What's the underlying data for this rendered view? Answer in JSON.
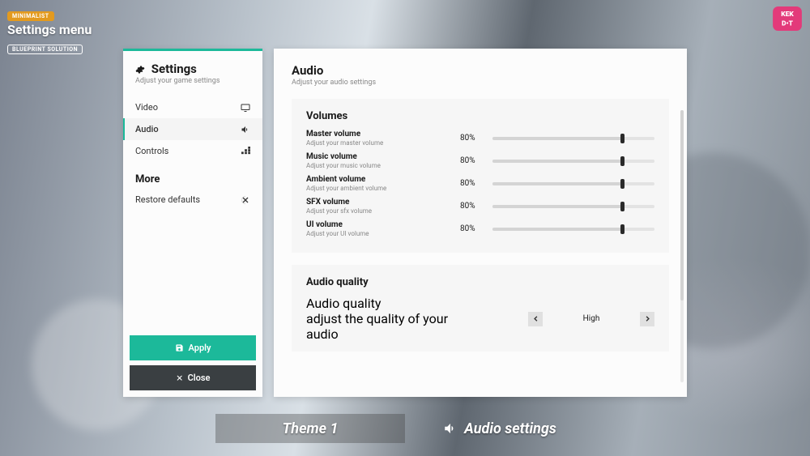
{
  "badges": {
    "mini": "MINIMALIST",
    "title": "Settings menu",
    "bp": "BLUEPRINT SOLUTION"
  },
  "logo": {
    "text": "KEK DOT"
  },
  "sidebar": {
    "title": "Settings",
    "subtitle": "Adjust your game settings",
    "items": [
      {
        "label": "Video",
        "icon": "monitor-icon",
        "active": false
      },
      {
        "label": "Audio",
        "icon": "speaker-icon",
        "active": true
      },
      {
        "label": "Controls",
        "icon": "grid-icon",
        "active": false
      }
    ],
    "more_label": "More",
    "more_items": [
      {
        "label": "Restore defaults",
        "icon": "reset-icon"
      }
    ],
    "apply_label": "Apply",
    "close_label": "Close"
  },
  "content": {
    "title": "Audio",
    "subtitle": "Adjust your audio settings",
    "volumes_title": "Volumes",
    "volumes": [
      {
        "name": "Master volume",
        "desc": "Adjust your master volume",
        "pct": 80,
        "display": "80%"
      },
      {
        "name": "Music volume",
        "desc": "Adjust your music volume",
        "pct": 80,
        "display": "80%"
      },
      {
        "name": "Ambient volume",
        "desc": "Adjust your ambient volume",
        "pct": 80,
        "display": "80%"
      },
      {
        "name": "SFX volume",
        "desc": "Adjust your sfx volume",
        "pct": 80,
        "display": "80%"
      },
      {
        "name": "UI volume",
        "desc": "Adjust your UI volume",
        "pct": 80,
        "display": "80%"
      }
    ],
    "quality_title": "Audio quality",
    "quality": {
      "name": "Audio quality",
      "desc": "adjust the quality of your audio",
      "value": "High"
    }
  },
  "caption": {
    "left": "Theme 1",
    "right": "Audio settings"
  },
  "colors": {
    "accent": "#1cb99a"
  }
}
